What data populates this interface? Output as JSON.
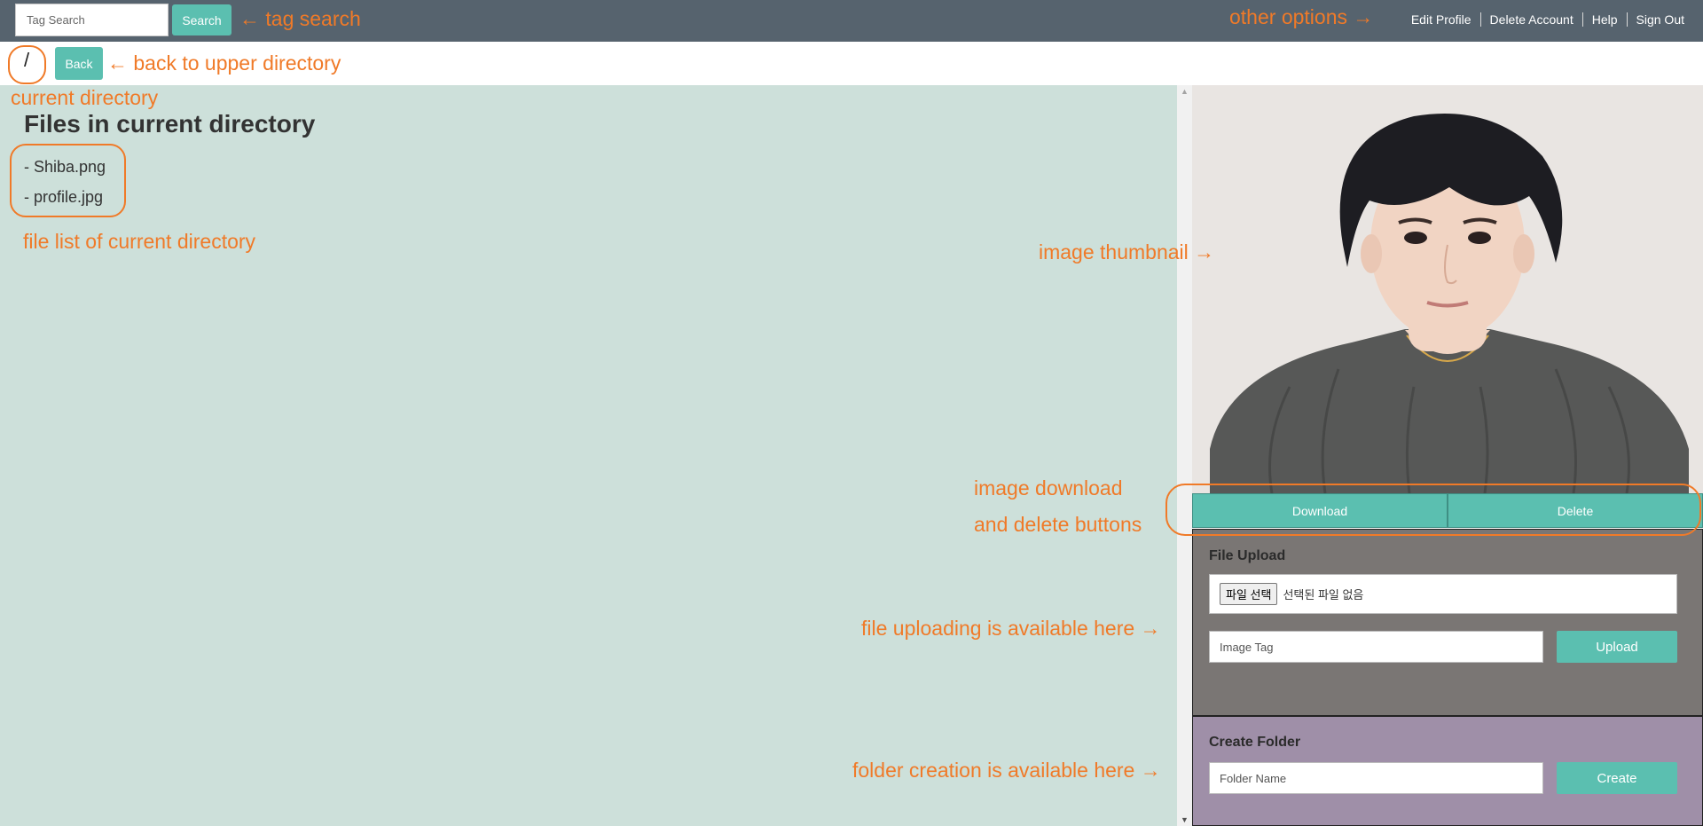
{
  "header": {
    "search": {
      "placeholder": "Tag Search",
      "button_label": "Search"
    },
    "nav": [
      "Edit Profile",
      "Delete Account",
      "Help",
      "Sign Out"
    ]
  },
  "directory": {
    "current": "/",
    "back_label": "Back"
  },
  "files": {
    "title": "Files in current directory",
    "items": [
      "- Shiba.png",
      "- profile.jpg"
    ]
  },
  "thumbnail": {
    "hair_color": "#1d1d22",
    "skin_color": "#f1d4c3",
    "sweater_color": "#575857",
    "background_color": "#e9e5e2"
  },
  "image_actions": {
    "download_label": "Download",
    "delete_label": "Delete"
  },
  "upload": {
    "title": "File Upload",
    "choose_label": "파일 선택",
    "no_file_text": "선택된 파일 없음",
    "tag_placeholder": "Image Tag",
    "button_label": "Upload"
  },
  "create_folder": {
    "title": "Create Folder",
    "name_placeholder": "Folder Name",
    "button_label": "Create"
  },
  "annotations": {
    "tag_search": "← tag search",
    "other_options": "other options →",
    "back_upper": "← back to upper directory",
    "current_directory": "current directory",
    "file_list": "file list of current directory",
    "image_thumbnail": "image thumbnail →",
    "download_delete_1": "image download",
    "download_delete_2": "and delete buttons",
    "file_uploading": "file uploading is available here →",
    "folder_creation": "folder creation is available here →"
  },
  "colors": {
    "topbar": "#56636e",
    "accent_teal": "#5bbfb0",
    "main_background": "#cde0da",
    "upload_panel": "#7a7674",
    "folder_panel": "#9f8fa8",
    "annotation": "#f07a28"
  }
}
